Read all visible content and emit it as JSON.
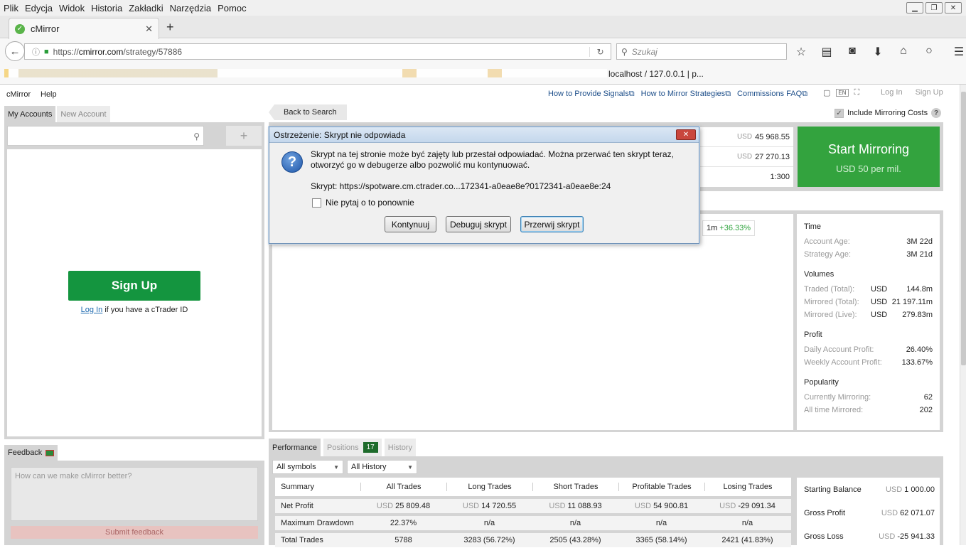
{
  "browser": {
    "menu": [
      "Plik",
      "Edycja",
      "Widok",
      "Historia",
      "Zakładki",
      "Narzędzia",
      "Pomoc"
    ],
    "tab_title": "cMirror",
    "url_prefix": "https://",
    "url_host": "cmirror.com",
    "url_path": "/strategy/57886",
    "search_placeholder": "Szukaj",
    "bookmark_visible": "localhost / 127.0.0.1 | p..."
  },
  "topnav": {
    "brand": "cMirror",
    "help": "Help",
    "links": [
      "How to Provide Signals",
      "How to Mirror Strategies",
      "Commissions FAQ"
    ],
    "lang": "EN",
    "login": "Log In",
    "signup": "Sign Up"
  },
  "left": {
    "tabs": [
      "My Accounts",
      "New Account"
    ],
    "plus": "+",
    "signup_button": "Sign Up",
    "login_link": "Log In",
    "login_suffix": " if you have a cTrader ID",
    "feedback_tab": "Feedback",
    "feedback_placeholder": "How can we make cMirror better?",
    "submit_feedback": "Submit feedback"
  },
  "strategy": {
    "back": "Back to Search",
    "include_mirroring": "Include Mirroring Costs",
    "account_rows": [
      {
        "cur": "USD",
        "value": "45 968.55"
      },
      {
        "cur": "USD",
        "value": "27 270.13"
      },
      {
        "cur": "",
        "value": "1:300"
      }
    ],
    "start_mirroring": "Start Mirroring",
    "start_price": "USD 50 per mil.",
    "period": {
      "label": "1m",
      "change": "+36.33%"
    }
  },
  "stats": {
    "time": {
      "title": "Time",
      "rows": [
        {
          "label": "Account Age:",
          "value": "3M 22d"
        },
        {
          "label": "Strategy Age:",
          "value": "3M 21d"
        }
      ]
    },
    "volumes": {
      "title": "Volumes",
      "rows": [
        {
          "label": "Traded (Total):",
          "cur": "USD",
          "value": "144.8m"
        },
        {
          "label": "Mirrored (Total):",
          "cur": "USD",
          "value": "21 197.11m"
        },
        {
          "label": "Mirrored (Live):",
          "cur": "USD",
          "value": "279.83m"
        }
      ]
    },
    "profit": {
      "title": "Profit",
      "rows": [
        {
          "label": "Daily Account Profit:",
          "value": "26.40%"
        },
        {
          "label": "Weekly Account Profit:",
          "value": "133.67%"
        }
      ]
    },
    "popularity": {
      "title": "Popularity",
      "rows": [
        {
          "label": "Currently Mirroring:",
          "value": "62"
        },
        {
          "label": "All time Mirrored:",
          "value": "202"
        }
      ]
    }
  },
  "perf": {
    "tabs": [
      "Performance",
      "Positions",
      "History"
    ],
    "positions_count": "17",
    "symbols": "All symbols",
    "history": "All History",
    "columns": [
      "Summary",
      "All Trades",
      "Long Trades",
      "Short Trades",
      "Profitable Trades",
      "Losing Trades"
    ],
    "rows": [
      {
        "label": "Net Profit",
        "cells": [
          {
            "cur": "USD",
            "v": "25 809.48"
          },
          {
            "cur": "USD",
            "v": "14 720.55"
          },
          {
            "cur": "USD",
            "v": "11 088.93"
          },
          {
            "cur": "USD",
            "v": "54 900.81"
          },
          {
            "cur": "USD",
            "v": "-29 091.34"
          }
        ]
      },
      {
        "label": "Maximum Drawdown",
        "cells": [
          {
            "cur": "",
            "v": "22.37%"
          },
          {
            "cur": "",
            "v": "n/a"
          },
          {
            "cur": "",
            "v": "n/a"
          },
          {
            "cur": "",
            "v": "n/a"
          },
          {
            "cur": "",
            "v": "n/a"
          }
        ]
      },
      {
        "label": "Total Trades",
        "cells": [
          {
            "cur": "",
            "v": "5788"
          },
          {
            "cur": "",
            "v": "3283 (56.72%)"
          },
          {
            "cur": "",
            "v": "2505 (43.28%)"
          },
          {
            "cur": "",
            "v": "3365 (58.14%)"
          },
          {
            "cur": "",
            "v": "2421 (41.83%)"
          }
        ]
      }
    ],
    "balances": [
      {
        "label": "Starting Balance",
        "cur": "USD",
        "v": "1 000.00"
      },
      {
        "label": "Gross Profit",
        "cur": "USD",
        "v": "62 071.07"
      },
      {
        "label": "Gross Loss",
        "cur": "USD",
        "v": "-25 941.33"
      }
    ]
  },
  "dialog": {
    "title": "Ostrzeżenie: Skrypt nie odpowiada",
    "message": "Skrypt na tej stronie może być zajęty lub przestał odpowiadać. Można przerwać ten skrypt teraz, otworzyć go w debugerze albo pozwolić mu kontynuować.",
    "script": "Skrypt: https://spotware.cm.ctrader.co...172341-a0eae8e?0172341-a0eae8e:24",
    "dont_ask": "Nie pytaj o to ponownie",
    "buttons": [
      "Kontynuuj",
      "Debuguj skrypt",
      "Przerwij skrypt"
    ]
  }
}
